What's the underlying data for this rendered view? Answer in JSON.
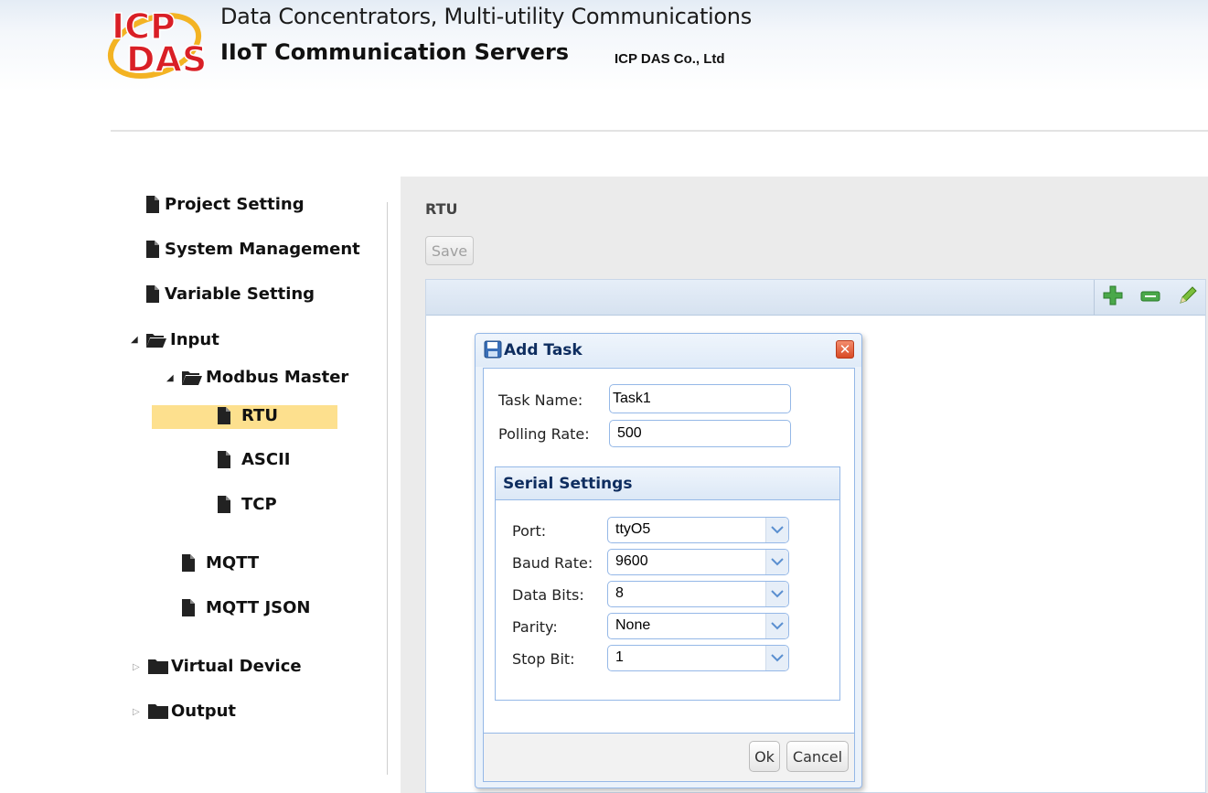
{
  "header": {
    "line1": "Data Concentrators, Multi-utility Communications",
    "line2": "IIoT Communication Servers",
    "company": "ICP DAS Co., Ltd",
    "logo_text_top": "ICP",
    "logo_text_bottom": "DAS"
  },
  "tree": {
    "items": [
      {
        "label": "Project Setting"
      },
      {
        "label": "System Management"
      },
      {
        "label": "Variable Setting"
      },
      {
        "label": "Input"
      },
      {
        "label": "Modbus Master"
      },
      {
        "label": "RTU"
      },
      {
        "label": "ASCII"
      },
      {
        "label": "TCP"
      },
      {
        "label": "MQTT"
      },
      {
        "label": "MQTT JSON"
      },
      {
        "label": "Virtual Device"
      },
      {
        "label": "Output"
      }
    ],
    "selected": "RTU"
  },
  "main": {
    "title": "RTU",
    "save_label": "Save",
    "toolbar": {
      "add_icon": "plus-icon",
      "remove_icon": "minus-icon",
      "edit_icon": "pencil-icon"
    }
  },
  "dialog": {
    "title": "Add Task",
    "task_name_label": "Task Name:",
    "task_name_value": "Task1",
    "polling_rate_label": "Polling Rate:",
    "polling_rate_value": "500",
    "serial": {
      "title": "Serial Settings",
      "port_label": "Port:",
      "port_value": "ttyO5",
      "baud_label": "Baud Rate:",
      "baud_value": "9600",
      "databits_label": "Data Bits:",
      "databits_value": "8",
      "parity_label": "Parity:",
      "parity_value": "None",
      "stopbit_label": "Stop Bit:",
      "stopbit_value": "1"
    },
    "ok_label": "Ok",
    "cancel_label": "Cancel"
  },
  "colors": {
    "accent": "#95b8e7",
    "selected_row": "#fde08e",
    "dialog_title": "#0e2d5f",
    "close_button": "#d84a25",
    "add_icon": "#3aa23a"
  }
}
